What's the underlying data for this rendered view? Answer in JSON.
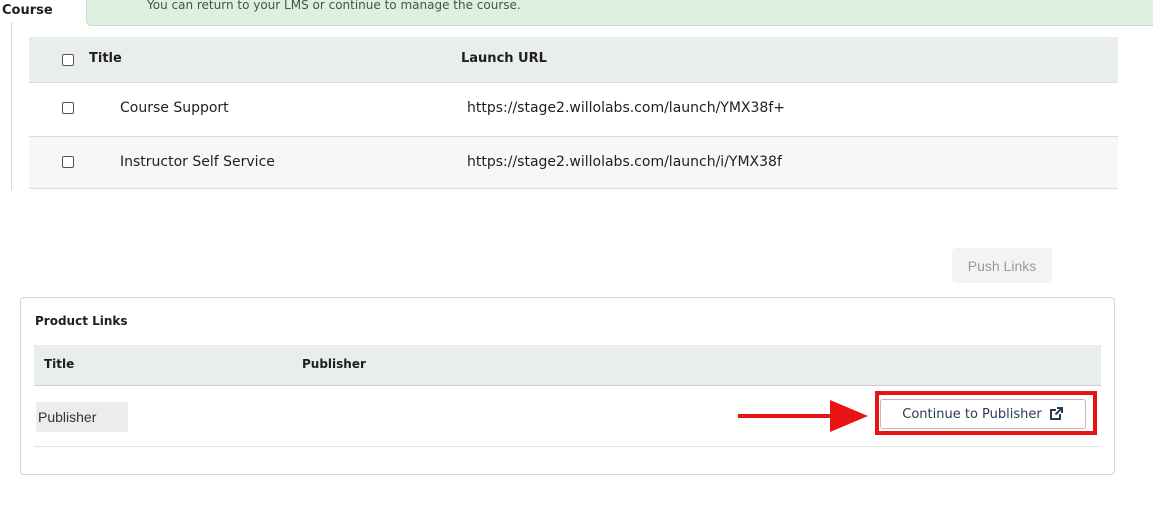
{
  "course_panel": {
    "label": "Course",
    "alert_text": "You can return to your LMS or continue to manage the course."
  },
  "course_links": {
    "columns": {
      "title": "Title",
      "launch_url": "Launch URL"
    },
    "rows": [
      {
        "title": "Course Support",
        "launch_url": "https://stage2.willolabs.com/launch/YMX38f+"
      },
      {
        "title": "Instructor Self Service",
        "launch_url": "https://stage2.willolabs.com/launch/i/YMX38f"
      }
    ]
  },
  "push_links_label": "Push Links",
  "product_links": {
    "heading": "Product Links",
    "columns": {
      "title": "Title",
      "publisher": "Publisher"
    },
    "rows": [
      {
        "title": "Publisher"
      }
    ],
    "continue_label": "Continue to Publisher",
    "continue_icon": "external-link-icon"
  },
  "annotation_colors": {
    "highlight": "#e81414"
  }
}
